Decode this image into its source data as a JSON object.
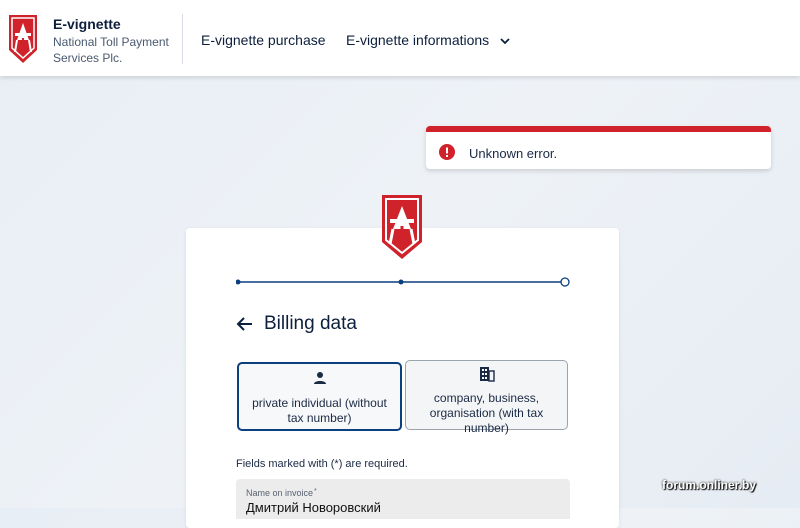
{
  "header": {
    "brand_title": "E-vignette",
    "brand_subtitle": "National Toll Payment Services Plc.",
    "nav": [
      {
        "label": "E-vignette purchase"
      },
      {
        "label": "E-vignette informations"
      }
    ]
  },
  "alert": {
    "text": "Unknown error.",
    "color": "#d0222a"
  },
  "form": {
    "title": "Billing data",
    "options": [
      {
        "label": "private individual (without tax number)",
        "icon": "person-icon",
        "selected": true
      },
      {
        "label": "company, business, organisation (with tax number)",
        "icon": "building-icon",
        "selected": false
      }
    ],
    "required_note": "Fields marked with (*) are required.",
    "name_field": {
      "label": "Name on invoice",
      "required_mark": "*",
      "value": "Дмитрий Новоровский"
    },
    "stepper_steps": 3,
    "stepper_current": 2
  },
  "watermark": "forum.onliner.by",
  "colors": {
    "brand_red": "#d0222a",
    "navy": "#0c3f7e",
    "text": "#0d1f3c"
  }
}
